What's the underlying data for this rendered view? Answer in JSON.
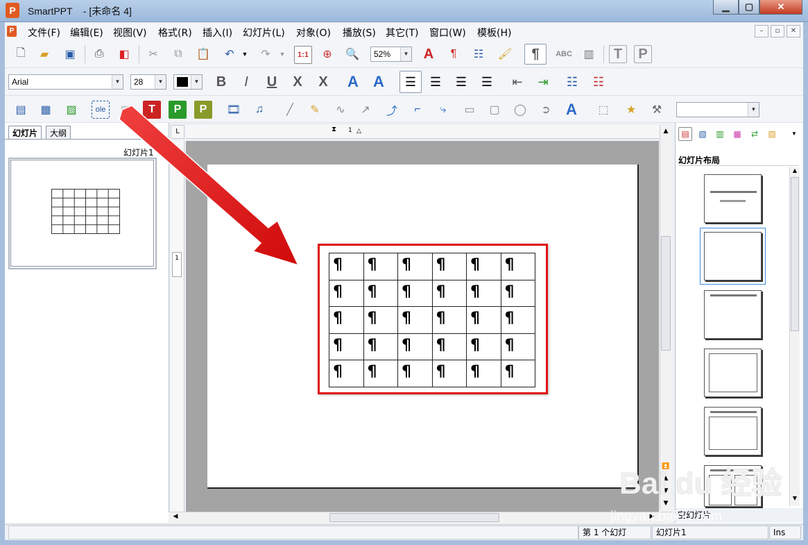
{
  "window": {
    "title": "SmartPPT    - [未命名 4]",
    "app_icon": "P",
    "controls": {
      "min": "▁",
      "max": "▢",
      "close": "✕"
    }
  },
  "menu": {
    "items": [
      "文件(F)",
      "编辑(E)",
      "视图(V)",
      "格式(R)",
      "插入(I)",
      "幻灯片(L)",
      "对象(O)",
      "播放(S)",
      "其它(T)",
      "窗口(W)",
      "模板(H)"
    ],
    "mdi_buttons": [
      "–",
      "▫",
      "✕"
    ]
  },
  "toolbar1": {
    "zoom": "52%",
    "fit_label": "1:1"
  },
  "toolbar2": {
    "font": "Arial",
    "size": "28"
  },
  "toolbar3": {
    "ole_label": "ole"
  },
  "left_panel": {
    "tabs": [
      "幻灯片",
      "大纲"
    ],
    "slide_label": "幻灯片1"
  },
  "ruler": {
    "corner": "L",
    "v_mark": "1",
    "h_mark": "1"
  },
  "right_panel": {
    "title": "幻灯片布局",
    "caption": "空幻灯片"
  },
  "slide_table": {
    "rows": [
      [
        "¶",
        "¶",
        "¶",
        "¶",
        "¶",
        "¶"
      ],
      [
        "¶",
        "¶",
        "¶",
        "¶",
        "¶",
        "¶"
      ],
      [
        "¶",
        "¶",
        "¶",
        "¶",
        "¶",
        "¶"
      ],
      [
        "¶",
        "¶",
        "¶",
        "¶",
        "¶",
        "¶"
      ],
      [
        "¶",
        "¶",
        "¶",
        "¶",
        "¶",
        "¶"
      ]
    ]
  },
  "status": {
    "slide_count": "第 1 个幻灯",
    "slide_name": "幻灯片1",
    "mode": "Ins"
  },
  "watermark": {
    "main": "Bai du 经验",
    "sub": "jingyan.baidu.com"
  },
  "colors": {
    "highlight": "#e01414",
    "arrow": "#e81010",
    "accent": "#e05a22"
  }
}
